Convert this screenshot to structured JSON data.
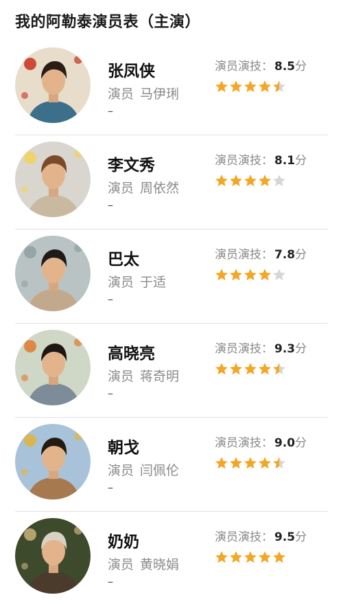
{
  "page": {
    "title": "我的阿勒泰演员表（主演）"
  },
  "labels": {
    "rating_prefix": "演员演技：",
    "rating_unit": "分",
    "actor_prefix": "演员",
    "dash": "–"
  },
  "colors": {
    "star_filled": "#f5a623",
    "star_empty": "#d6d6d6"
  },
  "cast": [
    {
      "role": "张凤侠",
      "actor": "马伊琍",
      "score": "8.5",
      "stars": 4.5,
      "avatar": {
        "bg": "#e8dccb",
        "accent": "#c7311f",
        "clothes": "#3b6f8a",
        "hair": "#2a1d15"
      }
    },
    {
      "role": "李文秀",
      "actor": "周依然",
      "score": "8.1",
      "stars": 4.0,
      "avatar": {
        "bg": "#d9d6cf",
        "accent": "#f2d35a",
        "clothes": "#c9b9a0",
        "hair": "#7a4a2a"
      }
    },
    {
      "role": "巴太",
      "actor": "于适",
      "score": "7.8",
      "stars": 4.0,
      "avatar": {
        "bg": "#b9c3c4",
        "accent": "#8fa0a3",
        "clothes": "#c2a98c",
        "hair": "#1e1a18"
      }
    },
    {
      "role": "高晓亮",
      "actor": "蒋奇明",
      "score": "9.3",
      "stars": 4.5,
      "avatar": {
        "bg": "#cfd7c6",
        "accent": "#e07a2e",
        "clothes": "#7d8c98",
        "hair": "#1c1712"
      }
    },
    {
      "role": "朝戈",
      "actor": "闫佩伦",
      "score": "9.0",
      "stars": 4.5,
      "avatar": {
        "bg": "#a8c3d9",
        "accent": "#e2b43a",
        "clothes": "#a7794f",
        "hair": "#231a13"
      }
    },
    {
      "role": "奶奶",
      "actor": "黄晓娟",
      "score": "9.5",
      "stars": 5.0,
      "avatar": {
        "bg": "#3d4a2c",
        "accent": "#c9b27a",
        "clothes": "#4a3b2d",
        "hair": "#d9d2c4"
      }
    }
  ]
}
